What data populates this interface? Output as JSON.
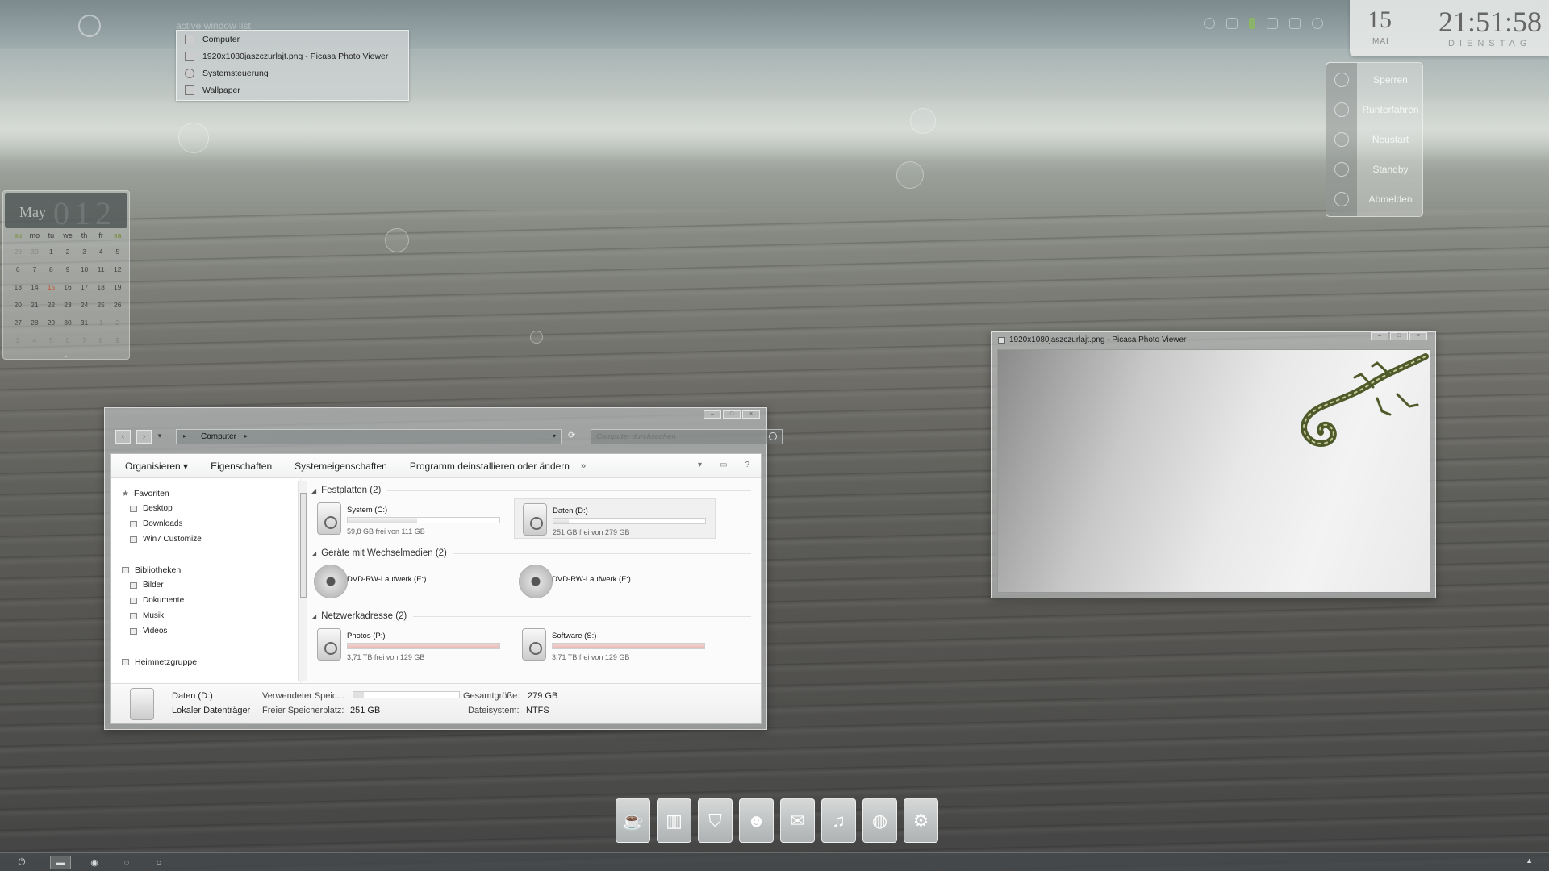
{
  "active_window_list": {
    "title": "active window list",
    "items": [
      {
        "label": "Computer",
        "icon": "computer-icon"
      },
      {
        "label": "1920x1080jaszczurlajt.png - Picasa Photo Viewer",
        "icon": "picasa-icon"
      },
      {
        "label": "Systemsteuerung",
        "icon": "control-panel-icon"
      },
      {
        "label": "Wallpaper",
        "icon": "folder-icon"
      }
    ]
  },
  "clock": {
    "day": "15",
    "month": "MAI",
    "time": "21:51:58",
    "weekday": "DIENSTAG"
  },
  "power_menu": {
    "items": [
      {
        "label": "Sperren",
        "icon": "lock-icon"
      },
      {
        "label": "Runterfahren",
        "icon": "power-icon"
      },
      {
        "label": "Neustart",
        "icon": "restart-icon"
      },
      {
        "label": "Standby",
        "icon": "standby-icon"
      },
      {
        "label": "Abmelden",
        "icon": "logoff-icon"
      }
    ]
  },
  "calendar": {
    "month": "May",
    "year": "012",
    "weekdays": [
      "su",
      "mo",
      "tu",
      "we",
      "th",
      "fr",
      "sa"
    ],
    "weeks": [
      [
        "29",
        "30",
        "1",
        "2",
        "3",
        "4",
        "5"
      ],
      [
        "6",
        "7",
        "8",
        "9",
        "10",
        "11",
        "12"
      ],
      [
        "13",
        "14",
        "15",
        "16",
        "17",
        "18",
        "19"
      ],
      [
        "20",
        "21",
        "22",
        "23",
        "24",
        "25",
        "26"
      ],
      [
        "27",
        "28",
        "29",
        "30",
        "31",
        "1",
        "2"
      ],
      [
        "3",
        "4",
        "5",
        "6",
        "7",
        "8",
        "9"
      ]
    ],
    "today": "15",
    "accent_color": "#c8502a"
  },
  "explorer": {
    "address": "Computer",
    "search_placeholder": "Computer durchsuchen",
    "toolbar": [
      "Organisieren",
      "Eigenschaften",
      "Systemeigenschaften",
      "Programm deinstallieren oder ändern"
    ],
    "toolbar_more": "»",
    "nav": {
      "favorites": "Favoriten",
      "favorites_items": [
        "Desktop",
        "Downloads",
        "Win7 Customize"
      ],
      "libraries": "Bibliotheken",
      "libraries_items": [
        "Bilder",
        "Dokumente",
        "Musik",
        "Videos"
      ],
      "homegroup": "Heimnetzgruppe"
    },
    "groups": [
      {
        "title": "Festplatten (2)"
      },
      {
        "title": "Geräte mit Wechselmedien (2)"
      },
      {
        "title": "Netzwerkadresse (2)"
      }
    ],
    "drives": {
      "c": {
        "name": "System (C:)",
        "free": "59,8 GB frei von 111 GB",
        "used_pct": 46
      },
      "d": {
        "name": "Daten (D:)",
        "free": "251 GB frei von 279 GB",
        "used_pct": 10
      },
      "e": {
        "name": "DVD-RW-Laufwerk (E:)"
      },
      "f": {
        "name": "DVD-RW-Laufwerk (F:)"
      },
      "p": {
        "name": "Photos (P:)",
        "free": "3,71 TB frei von 129 GB",
        "used_pct": 100
      },
      "s": {
        "name": "Software (S:)",
        "free": "3,71 TB frei von 129 GB",
        "used_pct": 100
      }
    },
    "details": {
      "name": "Daten (D:)",
      "type": "Lokaler Datenträger",
      "used_label": "Verwendeter Speic...",
      "free_label": "Freier Speicherplatz:",
      "free_value": "251 GB",
      "total_label": "Gesamtgröße:",
      "total_value": "279 GB",
      "fs_label": "Dateisystem:",
      "fs_value": "NTFS",
      "used_pct": 10
    }
  },
  "picasa": {
    "title": "1920x1080jaszczurlajt.png - Picasa Photo Viewer"
  },
  "dock": [
    "coffee-icon",
    "books-icon",
    "bag-icon",
    "users-icon",
    "mail-icon",
    "music-icon",
    "globe-icon",
    "settings-icon"
  ],
  "taskbar": [
    "power-icon",
    "explorer-icon",
    "picasa-icon",
    "control-icon",
    "wallpaper-icon"
  ]
}
